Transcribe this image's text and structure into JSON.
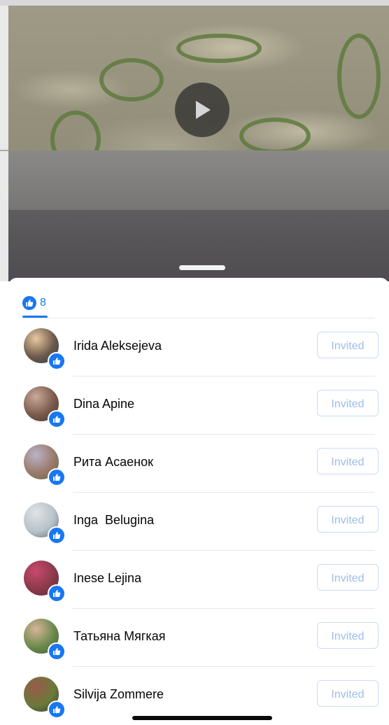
{
  "video": {
    "play_icon": "play-icon",
    "handle_icon": "drag-handle"
  },
  "reactions": {
    "tab_icon": "like-icon",
    "count": "8",
    "accent_color": "#1877f2"
  },
  "people": [
    {
      "name": "Irida Aleksejeva",
      "action_label": "Invited",
      "avatar_colors": [
        "#e9c9a2",
        "#6c5a4a",
        "#2e3b4f"
      ]
    },
    {
      "name": "Dina Apine",
      "action_label": "Invited",
      "avatar_colors": [
        "#c9a99a",
        "#7a5a4a",
        "#3d3a38"
      ]
    },
    {
      "name": "Рита Асаенок",
      "action_label": "Invited",
      "avatar_colors": [
        "#b9b3c8",
        "#9a7a6a",
        "#5a6a3e"
      ]
    },
    {
      "name": "Inga  Belugina",
      "action_label": "Invited",
      "avatar_colors": [
        "#dfe3e6",
        "#b8c2c9",
        "#5c6b77"
      ]
    },
    {
      "name": "Inese Lejina",
      "action_label": "Invited",
      "avatar_colors": [
        "#c84a6e",
        "#8a3a4a",
        "#5a2a3a"
      ]
    },
    {
      "name": "Татьяна Мягкая",
      "action_label": "Invited",
      "avatar_colors": [
        "#d9b49a",
        "#6a8a4a",
        "#3e5a3a"
      ]
    },
    {
      "name": "Silvija Zommere",
      "action_label": "Invited",
      "avatar_colors": [
        "#9a5a4a",
        "#6a7a3a",
        "#3a3a3a"
      ]
    }
  ]
}
